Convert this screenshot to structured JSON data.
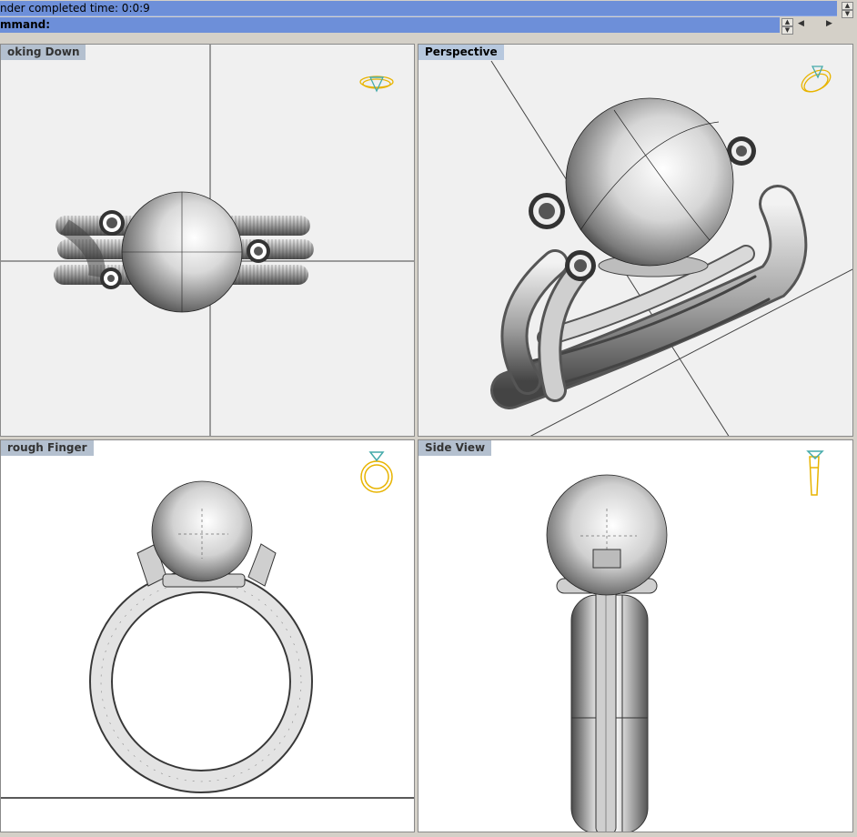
{
  "status": {
    "text": "nder completed time: 0:0:9"
  },
  "command": {
    "label": "mmand:",
    "value": ""
  },
  "viewports": {
    "top_left": {
      "title": "oking Down"
    },
    "top_right": {
      "title": "Perspective"
    },
    "bottom_left": {
      "title": "rough Finger"
    },
    "bottom_right": {
      "title": "Side View"
    }
  },
  "colors": {
    "title_bar": "#6d8fd9",
    "viewport_bg_top": "#f0f0f0",
    "viewport_bg_bottom": "#ffffff",
    "widget_gold": "#e8b400"
  },
  "icons": {
    "scroll_up": "▲",
    "scroll_down": "▼",
    "arrow_left": "◀",
    "arrow_right": "▶"
  }
}
